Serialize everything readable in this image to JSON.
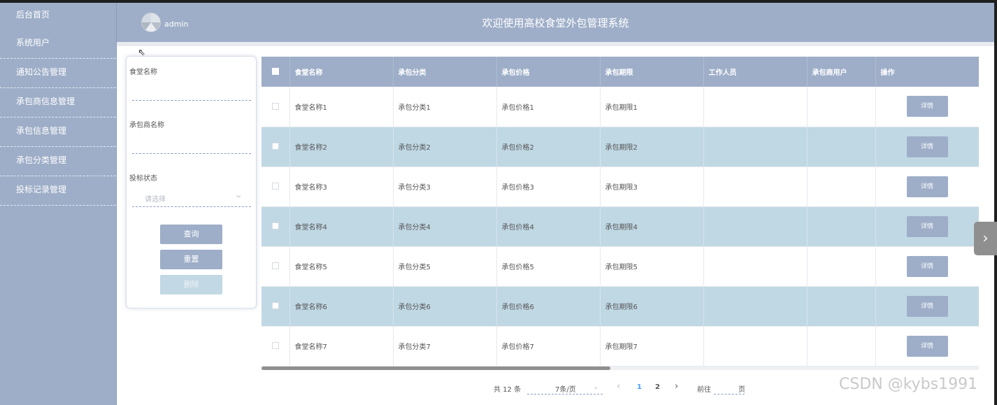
{
  "sidebar": {
    "items": [
      {
        "label": "后台首页"
      },
      {
        "label": "系统用户"
      },
      {
        "label": "通知公告管理"
      },
      {
        "label": "承包商信息管理"
      },
      {
        "label": "承包信息管理"
      },
      {
        "label": "承包分类管理"
      },
      {
        "label": "投标记录管理"
      }
    ]
  },
  "header": {
    "username": "admin",
    "title": "欢迎使用高校食堂外包管理系统"
  },
  "search": {
    "canteen_label": "食堂名称",
    "contractor_label": "承包商名称",
    "bid_status_label": "投标状态",
    "bid_status_placeholder": "请选择",
    "query_button": "查询",
    "reset_button": "重置",
    "delete_button": "删除"
  },
  "table": {
    "columns": [
      "食堂名称",
      "承包分类",
      "承包价格",
      "承包期限",
      "工作人员",
      "承包商用户",
      "操作"
    ],
    "rows": [
      [
        "食堂名称1",
        "承包分类1",
        "承包价格1",
        "承包期限1",
        "",
        ""
      ],
      [
        "食堂名称2",
        "承包分类2",
        "承包价格2",
        "承包期限2",
        "",
        ""
      ],
      [
        "食堂名称3",
        "承包分类3",
        "承包价格3",
        "承包期限3",
        "",
        ""
      ],
      [
        "食堂名称4",
        "承包分类4",
        "承包价格4",
        "承包期限4",
        "",
        ""
      ],
      [
        "食堂名称5",
        "承包分类5",
        "承包价格5",
        "承包期限5",
        "",
        ""
      ],
      [
        "食堂名称6",
        "承包分类6",
        "承包价格6",
        "承包期限6",
        "",
        ""
      ],
      [
        "食堂名称7",
        "承包分类7",
        "承包价格7",
        "承包期限7",
        "",
        ""
      ]
    ],
    "detail_label": "详情"
  },
  "pagination": {
    "total_text": "共 12 条",
    "page_size": "7条/页",
    "prev": "‹",
    "pages": [
      "1",
      "2"
    ],
    "current_page": "1",
    "next": "›",
    "goto_prefix": "前往",
    "goto_suffix": "页"
  },
  "watermark": "CSDN @kybs1991",
  "colors": {
    "accent": "#9eaec8",
    "row_alt": "#c0d8e4",
    "active_page": "#409eff",
    "disabled_button": "#c2d8e4"
  }
}
